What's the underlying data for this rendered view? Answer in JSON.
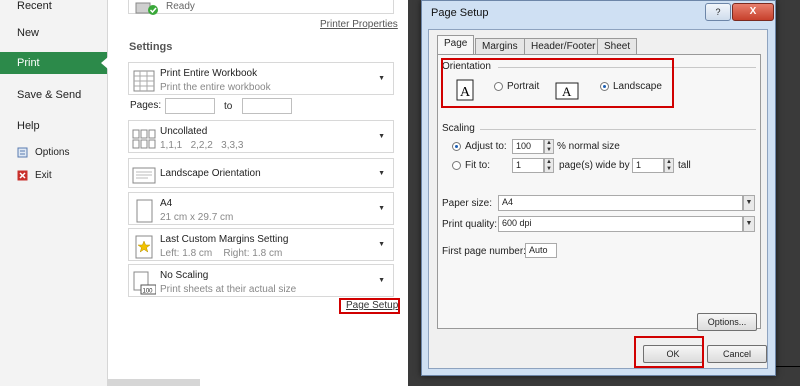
{
  "nav": {
    "items": [
      {
        "label": "Recent"
      },
      {
        "label": "New"
      },
      {
        "label": "Print"
      },
      {
        "label": "Save & Send"
      },
      {
        "label": "Help"
      },
      {
        "label": "Options"
      },
      {
        "label": "Exit"
      }
    ]
  },
  "printer": {
    "status": "Ready",
    "properties_link": "Printer Properties"
  },
  "settings": {
    "heading": "Settings",
    "what": {
      "title": "Print Entire Workbook",
      "sub": "Print the entire workbook"
    },
    "pages": {
      "label": "Pages:",
      "to": "to",
      "from_value": "",
      "to_value": ""
    },
    "collate": {
      "title": "Uncollated",
      "sub": "1,1,1   2,2,2   3,3,3"
    },
    "orientation": {
      "title": "Landscape Orientation"
    },
    "paper": {
      "title": "A4",
      "sub": "21 cm x 29.7 cm"
    },
    "margins": {
      "title": "Last Custom Margins Setting",
      "sub": "Left: 1.8 cm    Right: 1.8 cm"
    },
    "scaling": {
      "title": "No Scaling",
      "sub": "Print sheets at their actual size",
      "icon_text": "100"
    },
    "page_setup_link": "Page Setup"
  },
  "dialog": {
    "title": "Page Setup",
    "help": "?",
    "close": "X",
    "tabs": [
      "Page",
      "Margins",
      "Header/Footer",
      "Sheet"
    ],
    "orientation": {
      "label": "Orientation",
      "portrait": "Portrait",
      "landscape": "Landscape",
      "glyph": "A",
      "selected": "landscape"
    },
    "scaling": {
      "label": "Scaling",
      "adjust_to": "Adjust to:",
      "adjust_value": "100",
      "adjust_unit": "% normal size",
      "fit_to": "Fit to:",
      "fit_wide_value": "1",
      "fit_wide_label": "page(s) wide by",
      "fit_tall_value": "1",
      "fit_tall_label": "tall",
      "selected": "adjust"
    },
    "paper_size": {
      "label": "Paper size:",
      "value": "A4"
    },
    "print_quality": {
      "label": "Print quality:",
      "value": "600 dpi"
    },
    "first_page": {
      "label": "First page number:",
      "value": "Auto"
    },
    "buttons": {
      "options": "Options...",
      "ok": "OK",
      "cancel": "Cancel"
    }
  },
  "colors": {
    "accent_green": "#2c8a4a",
    "highlight_red": "#d10000",
    "dialog_frame": "#cfe0f3"
  }
}
